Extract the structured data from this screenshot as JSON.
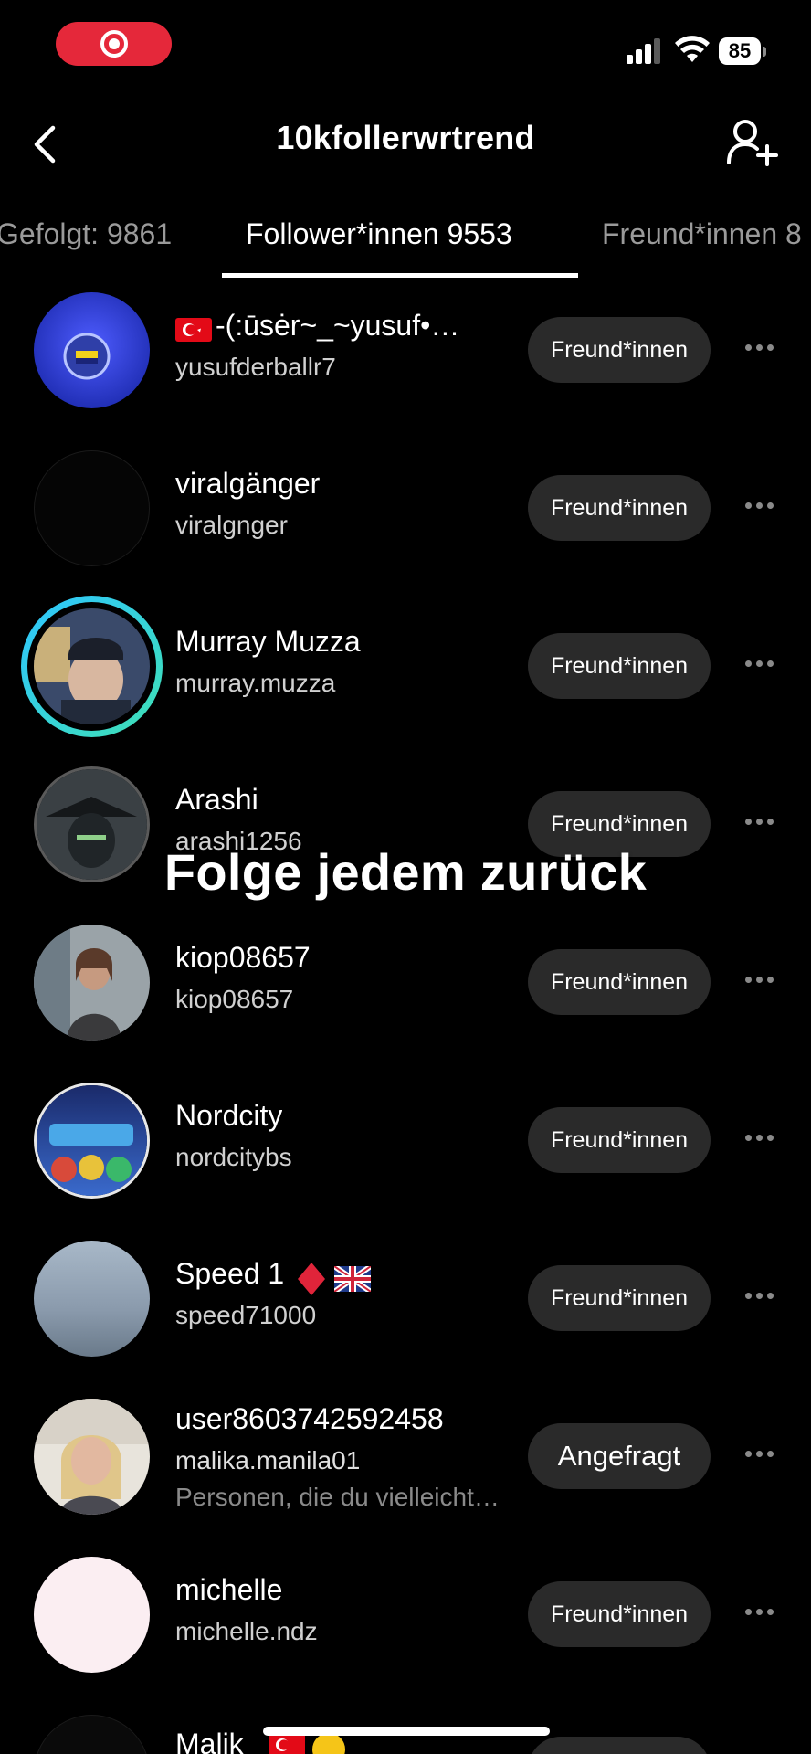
{
  "status_bar": {
    "battery": "85"
  },
  "header": {
    "title": "10kfollerwrtrend"
  },
  "tabs": [
    {
      "label": "Gefolgt: 9861"
    },
    {
      "label": "Follower*innen 9553"
    },
    {
      "label": "Freund*innen 8"
    }
  ],
  "overlay": {
    "caption": "Folge jedem zurück"
  },
  "users": [
    {
      "name": "-(:ūsėr~_~yusuf•…",
      "handle": "yusufderballr7",
      "button": "Freund*innen",
      "flag": "turkey"
    },
    {
      "name": "viralgänger",
      "handle": "viralgnger",
      "button": "Freund*innen"
    },
    {
      "name": "Murray Muzza",
      "handle": "murray.muzza",
      "button": "Freund*innen"
    },
    {
      "name": "Arashi",
      "handle": "arashi1256",
      "button": "Freund*innen"
    },
    {
      "name": "kiop08657",
      "handle": "kiop08657",
      "button": "Freund*innen"
    },
    {
      "name": "Nordcity",
      "handle": "nordcitybs",
      "button": "Freund*innen"
    },
    {
      "name": "Speed 1",
      "handle": "speed71000",
      "button": "Freund*innen",
      "icons": [
        "red-diamond-icon",
        "uk-flag-icon"
      ]
    },
    {
      "name": "user8603742592458",
      "handle": "malika.manila01",
      "subtitle": "Personen, die du vielleicht…",
      "button": "Angefragt"
    },
    {
      "name": "michelle",
      "handle": "michelle.ndz",
      "button": "Freund*innen"
    },
    {
      "name": "Malik",
      "handle": "",
      "button": "",
      "icons": [
        "turkey-flag-icon",
        "emoji-icon"
      ]
    }
  ],
  "colors": {
    "background": "#000000",
    "button_bg": "#2a2a2a",
    "record_pill": "#e5283a",
    "story_ring_start": "#2ec5ff",
    "story_ring_end": "#3fe0b5"
  }
}
